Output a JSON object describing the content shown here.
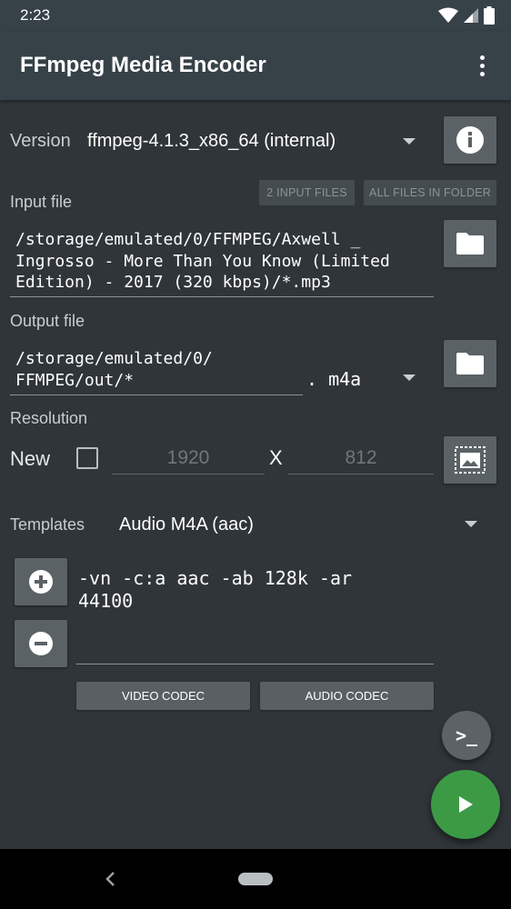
{
  "status": {
    "time": "2:23"
  },
  "app": {
    "title": "FFmpeg Media Encoder"
  },
  "version": {
    "label": "Version",
    "value": "ffmpeg-4.1.3_x86_64 (internal)"
  },
  "input": {
    "label": "Input file",
    "btn_two": "2 INPUT FILES",
    "btn_all": "ALL FILES IN FOLDER",
    "lines": [
      "/storage/emulated/0/FFMPEG/Axwell _",
      "Ingrosso - More Than You Know (Limited",
      "Edition) - 2017 (320 kbps)/*.mp3"
    ]
  },
  "output": {
    "label": "Output file",
    "lines": [
      "/storage/emulated/0/",
      "FFMPEG/out/*"
    ],
    "ext": ". m4a"
  },
  "resolution": {
    "label": "Resolution",
    "new_label": "New",
    "checked": false,
    "width_placeholder": "1920",
    "x": "X",
    "height_placeholder": "812"
  },
  "templates": {
    "label": "Templates",
    "value": "Audio M4A (aac)",
    "command_lines": [
      "-vn -c:a aac -ab 128k -ar",
      "44100"
    ],
    "second_value": ""
  },
  "codec": {
    "video": "VIDEO CODEC",
    "audio": "AUDIO CODEC"
  },
  "terminal_label": ">_",
  "icons": {
    "info": "info-icon",
    "folder": "folder-icon",
    "image": "image-icon",
    "add": "add-circle-icon",
    "remove": "remove-circle-icon",
    "play": "play-icon",
    "back": "back-icon",
    "home": "home-pill-icon"
  },
  "colors": {
    "accent_green": "#3c9a45",
    "background": "#2f3539",
    "appbar": "#374248"
  }
}
